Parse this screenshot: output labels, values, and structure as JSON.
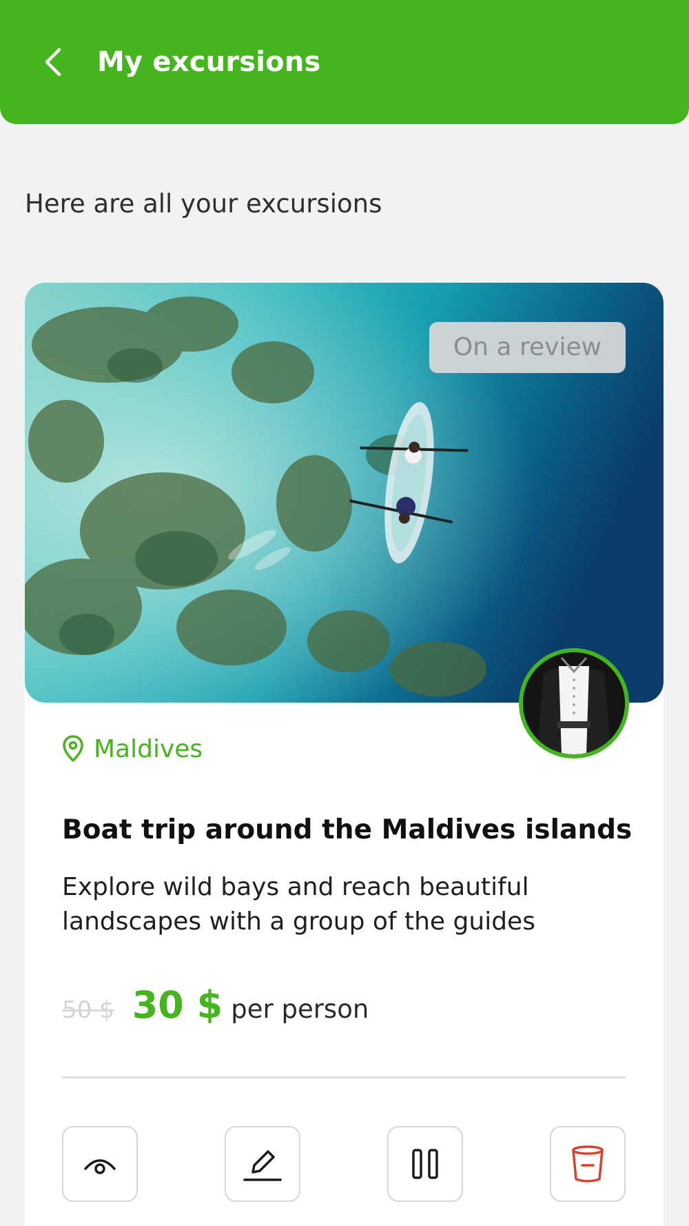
{
  "header": {
    "title": "My excursions",
    "back_icon": "chevron-left-icon"
  },
  "subtitle": "Here are all your excursions",
  "excursion": {
    "status": "On a review",
    "location": "Maldives",
    "title": "Boat trip around the Maldives islands",
    "description_line1": "Explore wild bays and reach beautiful",
    "description_line2": "landscapes with a group of the guides",
    "old_price": "50 $",
    "price": "30 $",
    "price_unit": "per person",
    "actions": [
      {
        "name": "view",
        "icon": "eye-icon"
      },
      {
        "name": "edit",
        "icon": "pencil-icon"
      },
      {
        "name": "pause",
        "icon": "pause-icon"
      },
      {
        "name": "delete",
        "icon": "trash-icon"
      }
    ]
  },
  "colors": {
    "accent": "#45b51e",
    "background": "#f2f2f2",
    "danger": "#d9412b"
  }
}
